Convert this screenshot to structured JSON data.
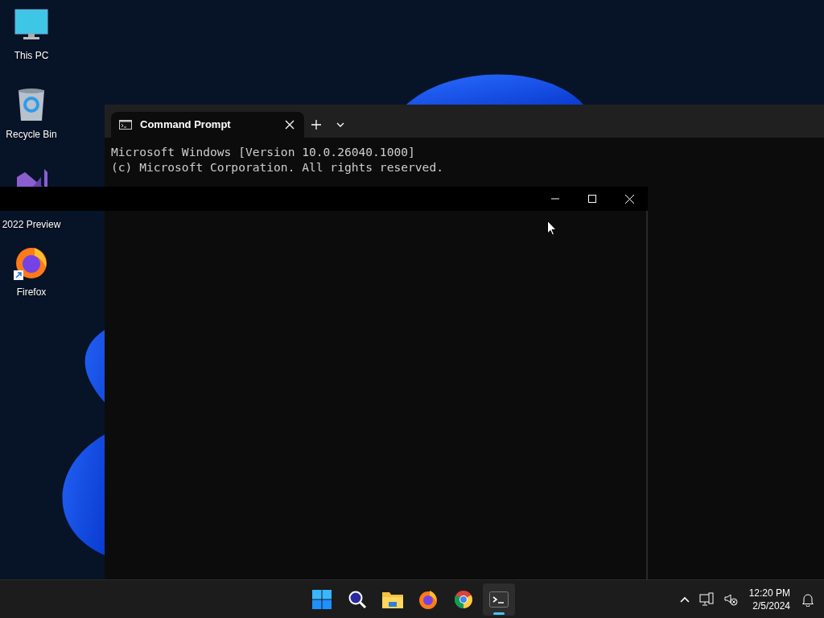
{
  "desktop_icons": [
    {
      "label": "This PC",
      "kind": "pc",
      "shortcut": false
    },
    {
      "label": "Recycle Bin",
      "kind": "bin",
      "shortcut": false
    },
    {
      "label": "2022 Preview",
      "kind": "vs",
      "shortcut": false
    },
    {
      "label": "Firefox",
      "kind": "firefox",
      "shortcut": true
    }
  ],
  "terminal": {
    "tabs": [
      {
        "title": "Command Prompt",
        "selected": true
      }
    ],
    "lines": [
      "Microsoft Windows [Version 10.0.26040.1000]",
      "(c) Microsoft Corporation. All rights reserved."
    ]
  },
  "taskbar": {
    "apps": [
      {
        "kind": "start",
        "running": false
      },
      {
        "kind": "search",
        "running": false
      },
      {
        "kind": "explorer",
        "running": false
      },
      {
        "kind": "firefox",
        "running": false
      },
      {
        "kind": "chrome",
        "running": false
      },
      {
        "kind": "terminal",
        "running": true
      }
    ],
    "time": "12:20 PM",
    "date": "2/5/2024"
  }
}
